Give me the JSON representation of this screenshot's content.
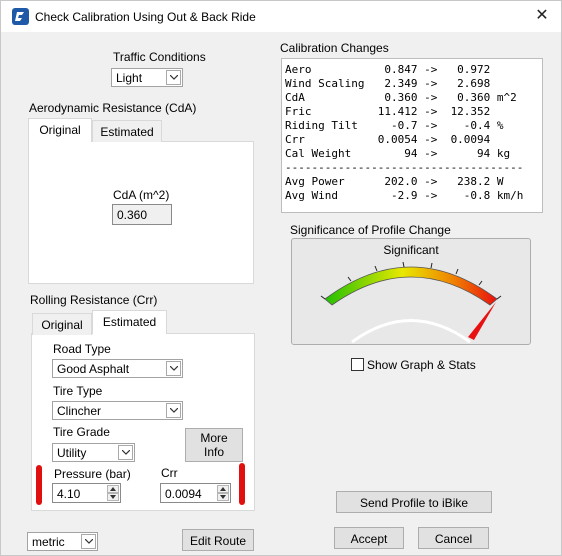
{
  "window": {
    "title": "Check Calibration Using Out & Back Ride"
  },
  "traffic": {
    "label": "Traffic Conditions",
    "value": "Light"
  },
  "aero": {
    "group_label": "Aerodynamic Resistance (CdA)",
    "tabs": [
      "Original",
      "Estimated"
    ],
    "cda_label": "CdA (m^2)",
    "cda_value": "0.360"
  },
  "rolling": {
    "group_label": "Rolling Resistance (Crr)",
    "tabs": [
      "Original",
      "Estimated"
    ],
    "road_type_label": "Road Type",
    "road_type_value": "Good Asphalt",
    "tire_type_label": "Tire Type",
    "tire_type_value": "Clincher",
    "tire_grade_label": "Tire Grade",
    "tire_grade_value": "Utility",
    "more_info": "More Info",
    "pressure_label": "Pressure (bar)",
    "pressure_value": "4.10",
    "crr_label": "Crr",
    "crr_value": "0.0094"
  },
  "calibration": {
    "label": "Calibration Changes",
    "rows": [
      {
        "name": "Aero",
        "from": "0.847",
        "to": "0.972",
        "unit": ""
      },
      {
        "name": "Wind Scaling",
        "from": "2.349",
        "to": "2.698",
        "unit": ""
      },
      {
        "name": "CdA",
        "from": "0.360",
        "to": "0.360",
        "unit": "m^2"
      },
      {
        "name": "Fric",
        "from": "11.412",
        "to": "12.352",
        "unit": ""
      },
      {
        "name": "Riding Tilt",
        "from": "-0.7",
        "to": "-0.4",
        "unit": "%"
      },
      {
        "name": "Crr",
        "from": "0.0054",
        "to": "0.0094",
        "unit": ""
      },
      {
        "name": "Cal Weight",
        "from": "94",
        "to": "94",
        "unit": "kg"
      }
    ],
    "separator": "------------------------------------",
    "rows2": [
      {
        "name": "Avg Power",
        "from": "202.0",
        "to": "238.2",
        "unit": "W"
      },
      {
        "name": "Avg Wind",
        "from": "-2.9",
        "to": "-0.8",
        "unit": "km/h"
      }
    ]
  },
  "significance": {
    "label": "Significance of Profile Change",
    "gauge_text": "Significant",
    "needle_fraction": 0.95
  },
  "show_graph": {
    "label": "Show Graph & Stats",
    "checked": false
  },
  "units": {
    "value": "metric"
  },
  "buttons": {
    "edit_route": "Edit Route",
    "send_profile": "Send Profile to iBike",
    "accept": "Accept",
    "cancel": "Cancel"
  },
  "colors": {
    "highlight_red": "#e01010",
    "gauge_green": "#22c000",
    "gauge_yellow": "#e8e800",
    "gauge_red": "#e81010"
  }
}
